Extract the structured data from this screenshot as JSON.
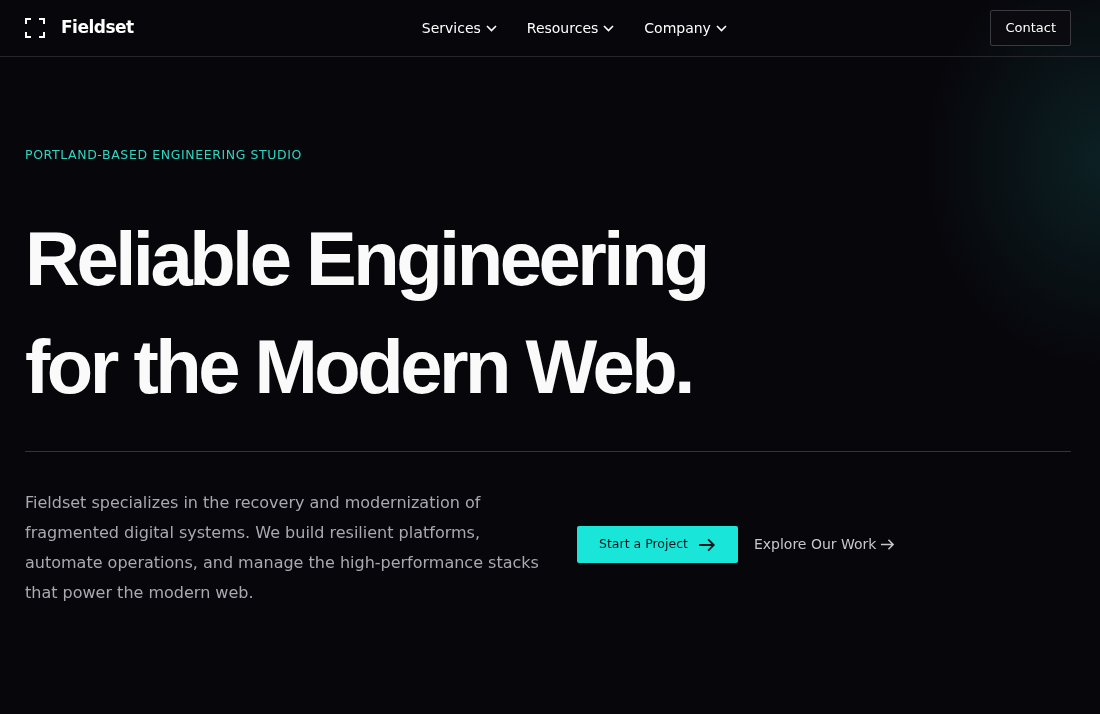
{
  "navbar": {
    "brand": "Fieldset",
    "menu": [
      {
        "label": "Services"
      },
      {
        "label": "Resources"
      },
      {
        "label": "Company"
      }
    ],
    "contact": "Contact"
  },
  "hero": {
    "eyebrow": "PORTLAND-BASED ENGINEERING STUDIO",
    "headline": [
      "Reliable Engineering",
      "for the Modern Web."
    ],
    "description": "Fieldset specializes in the recovery and modernization of fragmented digital systems. We build resilient platforms, automate operations, and manage the high-performance stacks that power the modern web.",
    "primary_button": "Start a Project",
    "secondary_link": "Explore Our Work"
  }
}
